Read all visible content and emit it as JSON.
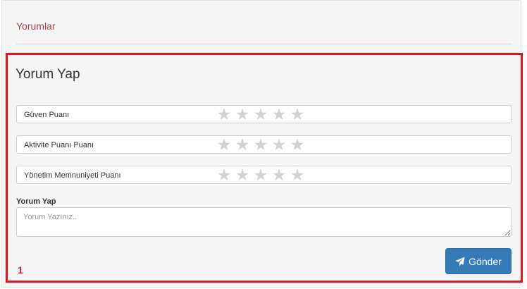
{
  "section": {
    "title": "Yorumlar"
  },
  "form": {
    "title": "Yorum Yap",
    "ratings": [
      {
        "label": "Güven Puanı",
        "stars": 0,
        "max": 5
      },
      {
        "label": "Aktivite Puanı Puanı",
        "stars": 0,
        "max": 5
      },
      {
        "label": "Yönetim Memnuniyeti Puanı",
        "stars": 0,
        "max": 5
      }
    ],
    "comment": {
      "label": "Yorum Yap",
      "placeholder": "Yorum Yazınız..",
      "value": ""
    },
    "submit_label": "Gönder"
  },
  "annotation": {
    "marker": "1"
  },
  "colors": {
    "accent": "#337ab7",
    "header_text": "#a8424a",
    "highlight": "#e3161c",
    "star_empty": "#d2d2d2"
  },
  "icons": {
    "star": "star-icon",
    "send": "paper-plane-icon"
  }
}
